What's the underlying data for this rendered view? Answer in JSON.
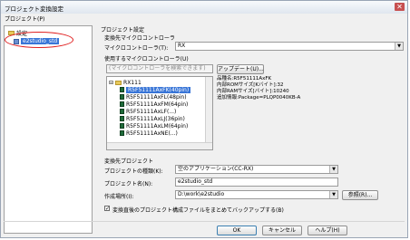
{
  "window": {
    "title": "プロジェクト変換設定",
    "close_glyph": "✕"
  },
  "menu": {
    "project": "プロジェクト(P)"
  },
  "tree": {
    "root_label": "設定",
    "project_label": "e2studio_std"
  },
  "settings": {
    "section_title": "プロジェクト設定",
    "target_mc_group": "変換先マイクロコントローラ",
    "mc_label": "マイクロコントローラ(T):",
    "mc_value": "RX",
    "usable_mc_label": "使用するマイクロコントローラ(U)",
    "search_placeholder": "(マイクロコントローラを検索できます)",
    "update_button": "アップデート(U)...",
    "mc_group_node": "RX111",
    "mc_list": [
      "R5F51111AxFK(40pin)",
      "R5F51111AxFL(48pin)",
      "R5F51111AxFM(64pin)",
      "R5F51111AxLF(...)",
      "R5F51111AxLJ(36pin)",
      "R5F51111AxLM(64pin)",
      "R5F51111AxNE(...)"
    ],
    "mc_info": [
      "品種名:R5F51111AxFK",
      "内部ROMサイズ[Kバイト]:32",
      "内部RAMサイズ[バイト]:10240",
      "追加情報:Package=PLQP0040KB-A"
    ],
    "target_project_group": "変換先プロジェクト",
    "project_type_label": "プロジェクトの種類(K):",
    "project_type_value": "空のアプリケーション(CC-RX)",
    "project_name_label": "プロジェクト名(N):",
    "project_name_value": "e2studio_std",
    "location_label": "作成場所(I):",
    "location_value": "D:\\work\\e2studio",
    "browse_button": "参照(R)...",
    "backup_check_label": "変換直後のプロジェクト構成ファイルをまとめてバックアップする(B)",
    "backup_checked": true
  },
  "buttons": {
    "ok": "OK",
    "cancel": "キャンセル",
    "help": "ヘルプ(H)"
  }
}
